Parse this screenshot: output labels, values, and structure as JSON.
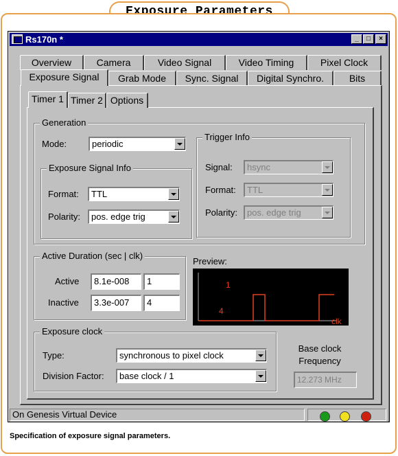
{
  "figure": {
    "title": "Exposure Parameters",
    "caption": "Specification of exposure signal parameters."
  },
  "window": {
    "title": "Rs170n *",
    "buttons": {
      "minimize": "_",
      "maximize": "□",
      "close": "×"
    }
  },
  "tabs": {
    "row1": [
      "Overview",
      "Camera",
      "Video Signal",
      "Video Timing",
      "Pixel Clock"
    ],
    "row2": [
      "Exposure Signal",
      "Grab Mode",
      "Sync. Signal",
      "Digital Synchro.",
      "Bits"
    ],
    "active": "Exposure Signal"
  },
  "subtabs": {
    "items": [
      "Timer 1",
      "Timer 2",
      "Options"
    ],
    "active": "Timer 1"
  },
  "generation": {
    "title": "Generation",
    "mode_label": "Mode:",
    "mode_value": "periodic",
    "exposure_info": {
      "title": "Exposure Signal Info",
      "format_label": "Format:",
      "format_value": "TTL",
      "polarity_label": "Polarity:",
      "polarity_value": "pos. edge trig"
    },
    "trigger_info": {
      "title": "Trigger Info",
      "signal_label": "Signal:",
      "signal_value": "hsync",
      "format_label": "Format:",
      "format_value": "TTL",
      "polarity_label": "Polarity:",
      "polarity_value": "pos. edge trig"
    }
  },
  "active_duration": {
    "title": "Active Duration (sec | clk)",
    "active_label": "Active",
    "active_sec": "8.1e-008",
    "active_clk": "1",
    "inactive_label": "Inactive",
    "inactive_sec": "3.3e-007",
    "inactive_clk": "4"
  },
  "preview": {
    "label": "Preview:",
    "high_label": "1",
    "low_label": "4",
    "axis_label": "clk",
    "colors": {
      "background": "#000000",
      "axis": "#b0b0b0",
      "signal": "#e04020"
    }
  },
  "exposure_clock": {
    "title": "Exposure clock",
    "type_label": "Type:",
    "type_value": "synchronous to pixel clock",
    "division_label": "Division Factor:",
    "division_value": "base clock / 1",
    "base_clock_label_1": "Base clock",
    "base_clock_label_2": "Frequency",
    "base_clock_value": "12.273 MHz"
  },
  "status": {
    "text": "On Genesis Virtual Device",
    "lights": [
      "#1a9a1a",
      "#f0e020",
      "#d02010"
    ]
  }
}
